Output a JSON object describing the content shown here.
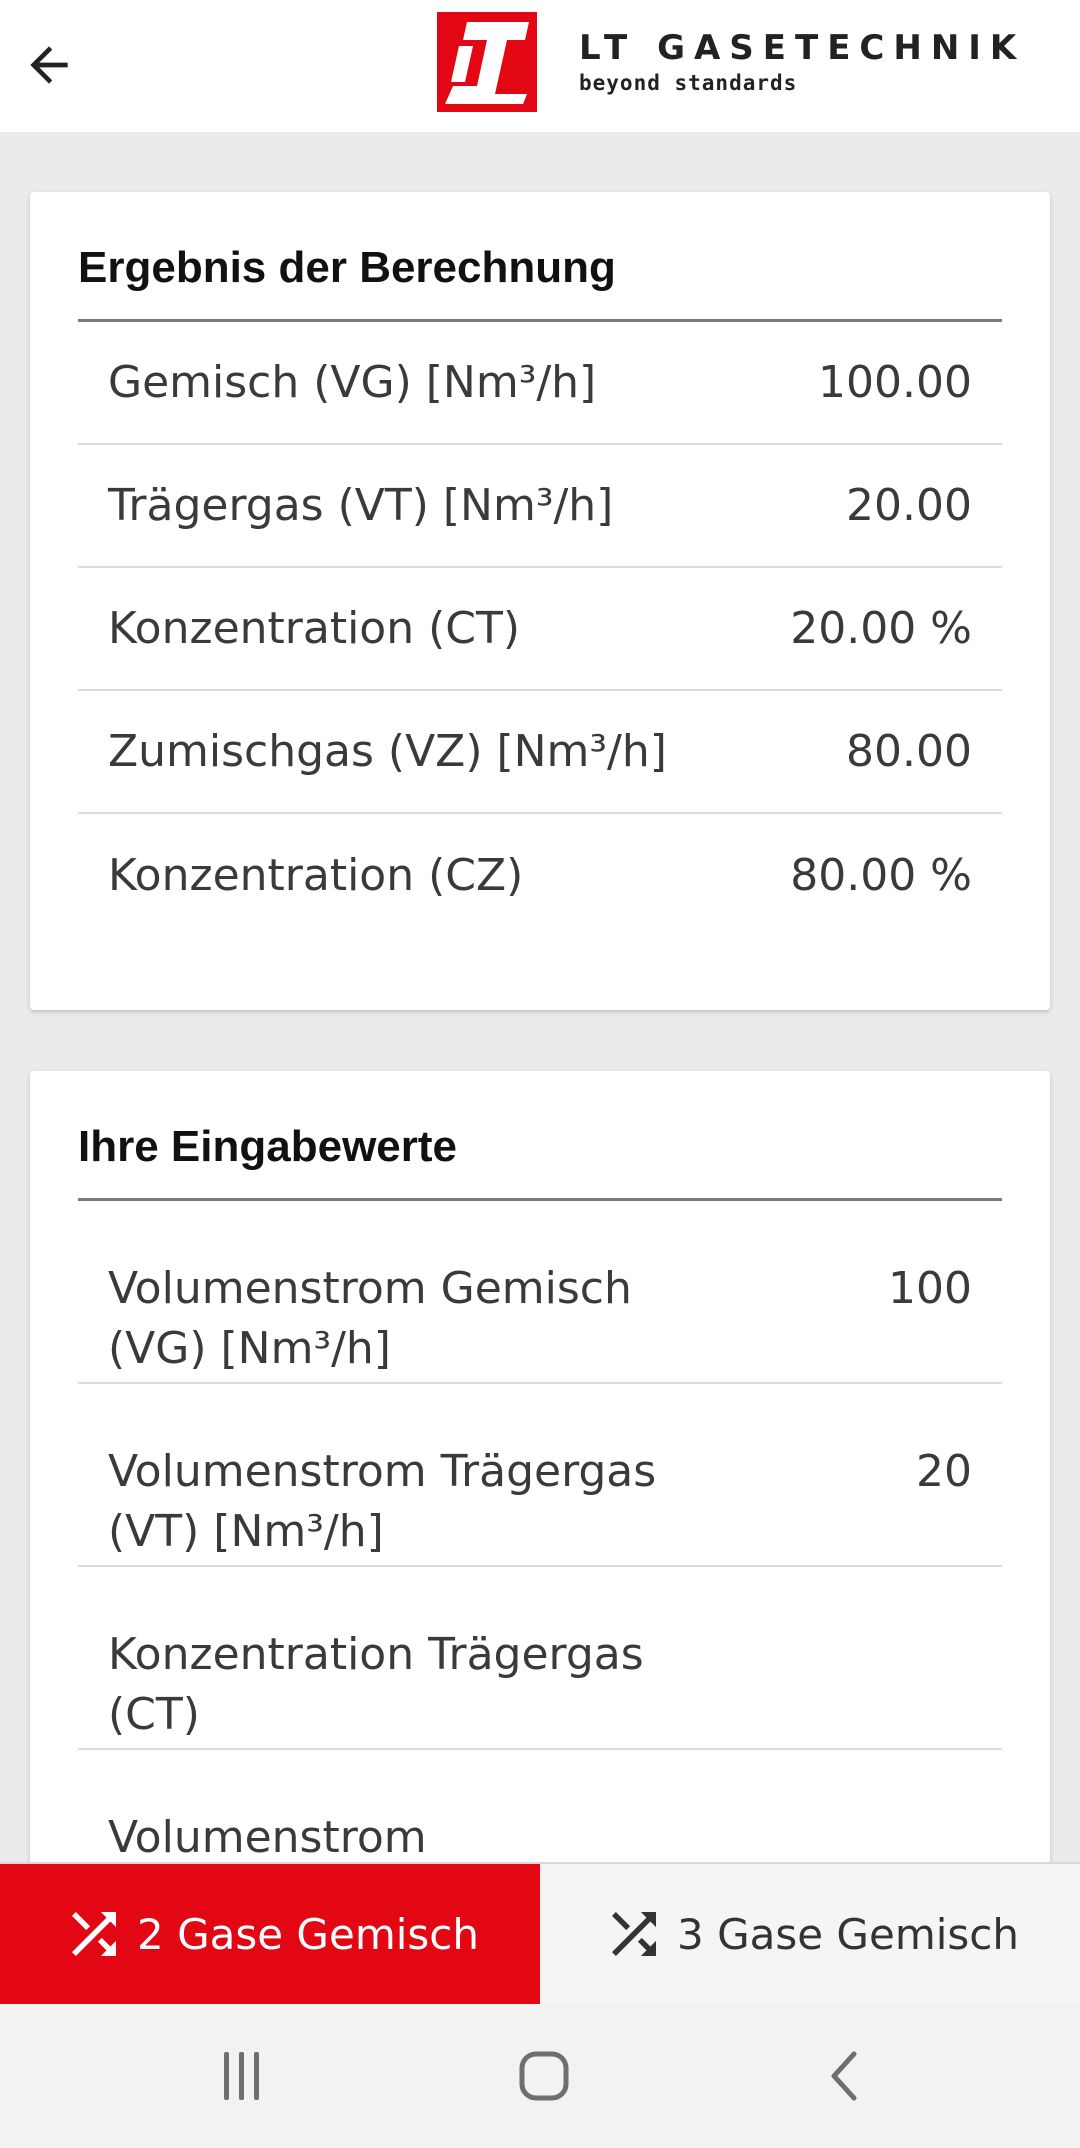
{
  "header": {
    "back_icon": "arrow-left-icon",
    "brand_name": "LT GASETECHNIK",
    "brand_tagline": "beyond standards",
    "brand_logo_text": "LT",
    "brand_color": "#e30613"
  },
  "results": {
    "title": "Ergebnis der Berechnung",
    "rows": [
      {
        "label": "Gemisch (VG) [Nm³/h]",
        "value": "100.00"
      },
      {
        "label": "Trägergas (VT) [Nm³/h]",
        "value": "20.00"
      },
      {
        "label": "Konzentration (CT)",
        "value": "20.00 %"
      },
      {
        "label": "Zumischgas (VZ) [Nm³/h]",
        "value": "80.00"
      },
      {
        "label": "Konzentration (CZ)",
        "value": "80.00 %"
      }
    ]
  },
  "inputs": {
    "title": "Ihre Eingabewerte",
    "rows": [
      {
        "label": "Volumenstrom Gemisch (VG) [Nm³/h]",
        "value": "100"
      },
      {
        "label": "Volumenstrom Trägergas (VT) [Nm³/h]",
        "value": "20"
      },
      {
        "label": "Konzentration Trägergas (CT)",
        "value": ""
      },
      {
        "label": "Volumenstrom",
        "value": ""
      }
    ]
  },
  "tabs": [
    {
      "label": "2 Gase Gemisch",
      "icon": "shuffle-icon",
      "active": true
    },
    {
      "label": "3 Gase Gemisch",
      "icon": "shuffle-icon",
      "active": false
    }
  ],
  "system_nav": {
    "recents_icon": "recents-icon",
    "home_icon": "home-icon",
    "back_icon": "chevron-left-icon"
  },
  "colors": {
    "accent": "#e30613",
    "background": "#ebebeb",
    "card": "#ffffff",
    "text": "#333333"
  }
}
